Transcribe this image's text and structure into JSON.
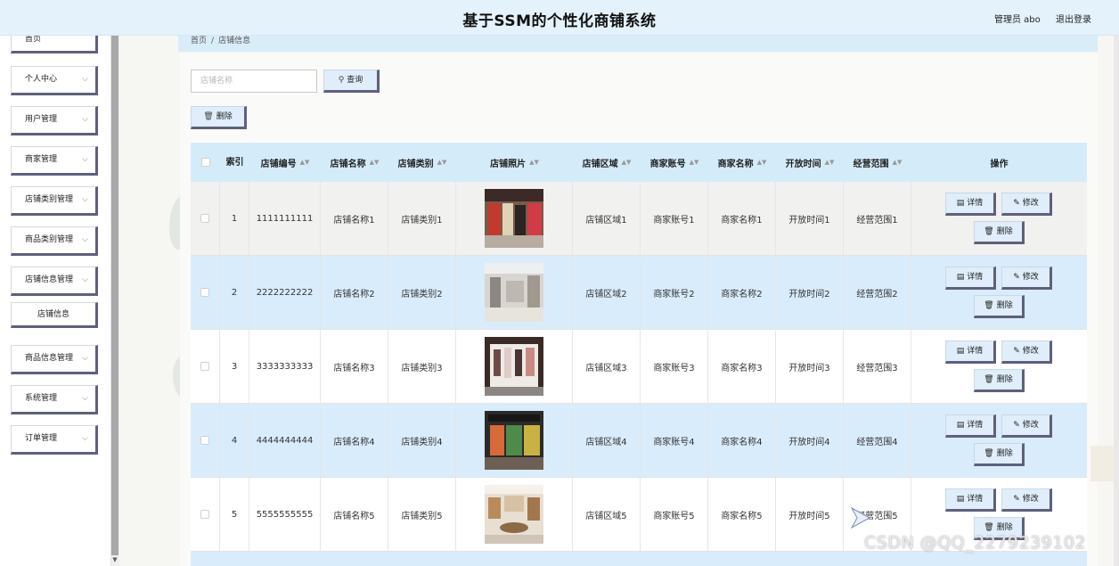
{
  "header": {
    "title": "基于SSM的个性化商铺系统",
    "admin": "管理员 abo",
    "logout": "退出登录"
  },
  "sidebar": {
    "items": [
      {
        "label": "首页",
        "chevron": false
      },
      {
        "label": "个人中心",
        "chevron": true
      },
      {
        "label": "用户管理",
        "chevron": true
      },
      {
        "label": "商家管理",
        "chevron": true
      },
      {
        "label": "店铺类别管理",
        "chevron": true
      },
      {
        "label": "商品类别管理",
        "chevron": true
      },
      {
        "label": "店铺信息管理",
        "chevron": true
      },
      {
        "label": "商品信息管理",
        "chevron": true
      },
      {
        "label": "系统管理",
        "chevron": true
      },
      {
        "label": "订单管理",
        "chevron": true
      }
    ],
    "sub_item": "店铺信息"
  },
  "breadcrumb": {
    "home": "首页",
    "separator": "/",
    "current": "店铺信息"
  },
  "search": {
    "placeholder": "店铺名称",
    "query_label": "查询"
  },
  "toolbar": {
    "delete_label": "删除"
  },
  "table": {
    "headers": {
      "index": "索引",
      "shop_no": "店铺编号",
      "shop_name": "店铺名称",
      "shop_category": "店铺类别",
      "shop_photo": "店铺照片",
      "shop_area": "店铺区域",
      "merchant_account": "商家账号",
      "merchant_name": "商家名称",
      "open_time": "开放时间",
      "business_scope": "经营范围",
      "actions": "操作"
    },
    "rows": [
      {
        "index": "1",
        "shop_no": "1111111111",
        "shop_name": "店铺名称1",
        "shop_category": "店铺类别1",
        "shop_area": "店铺区域1",
        "merchant_account": "商家账号1",
        "merchant_name": "商家名称1",
        "open_time": "开放时间1",
        "business_scope": "经营范围1"
      },
      {
        "index": "2",
        "shop_no": "2222222222",
        "shop_name": "店铺名称2",
        "shop_category": "店铺类别2",
        "shop_area": "店铺区域2",
        "merchant_account": "商家账号2",
        "merchant_name": "商家名称2",
        "open_time": "开放时间2",
        "business_scope": "经营范围2"
      },
      {
        "index": "3",
        "shop_no": "3333333333",
        "shop_name": "店铺名称3",
        "shop_category": "店铺类别3",
        "shop_area": "店铺区域3",
        "merchant_account": "商家账号3",
        "merchant_name": "商家名称3",
        "open_time": "开放时间3",
        "business_scope": "经营范围3"
      },
      {
        "index": "4",
        "shop_no": "4444444444",
        "shop_name": "店铺名称4",
        "shop_category": "店铺类别4",
        "shop_area": "店铺区域4",
        "merchant_account": "商家账号4",
        "merchant_name": "商家名称4",
        "open_time": "开放时间4",
        "business_scope": "经营范围4"
      },
      {
        "index": "5",
        "shop_no": "5555555555",
        "shop_name": "店铺名称5",
        "shop_category": "店铺类别5",
        "shop_area": "店铺区域5",
        "merchant_account": "商家账号5",
        "merchant_name": "商家名称5",
        "open_time": "开放时间5",
        "business_scope": "经营范围5"
      }
    ],
    "actions": {
      "detail": "详情",
      "edit": "修改",
      "delete": "删除"
    }
  },
  "watermark": "CSDN @QQ_2279239102",
  "colors": {
    "header_bg": "#e4f2fb",
    "row_alt_bg": "#d9ecfb",
    "button_shadow": "#5f607c",
    "table_header_bg": "#d4ebfa"
  }
}
